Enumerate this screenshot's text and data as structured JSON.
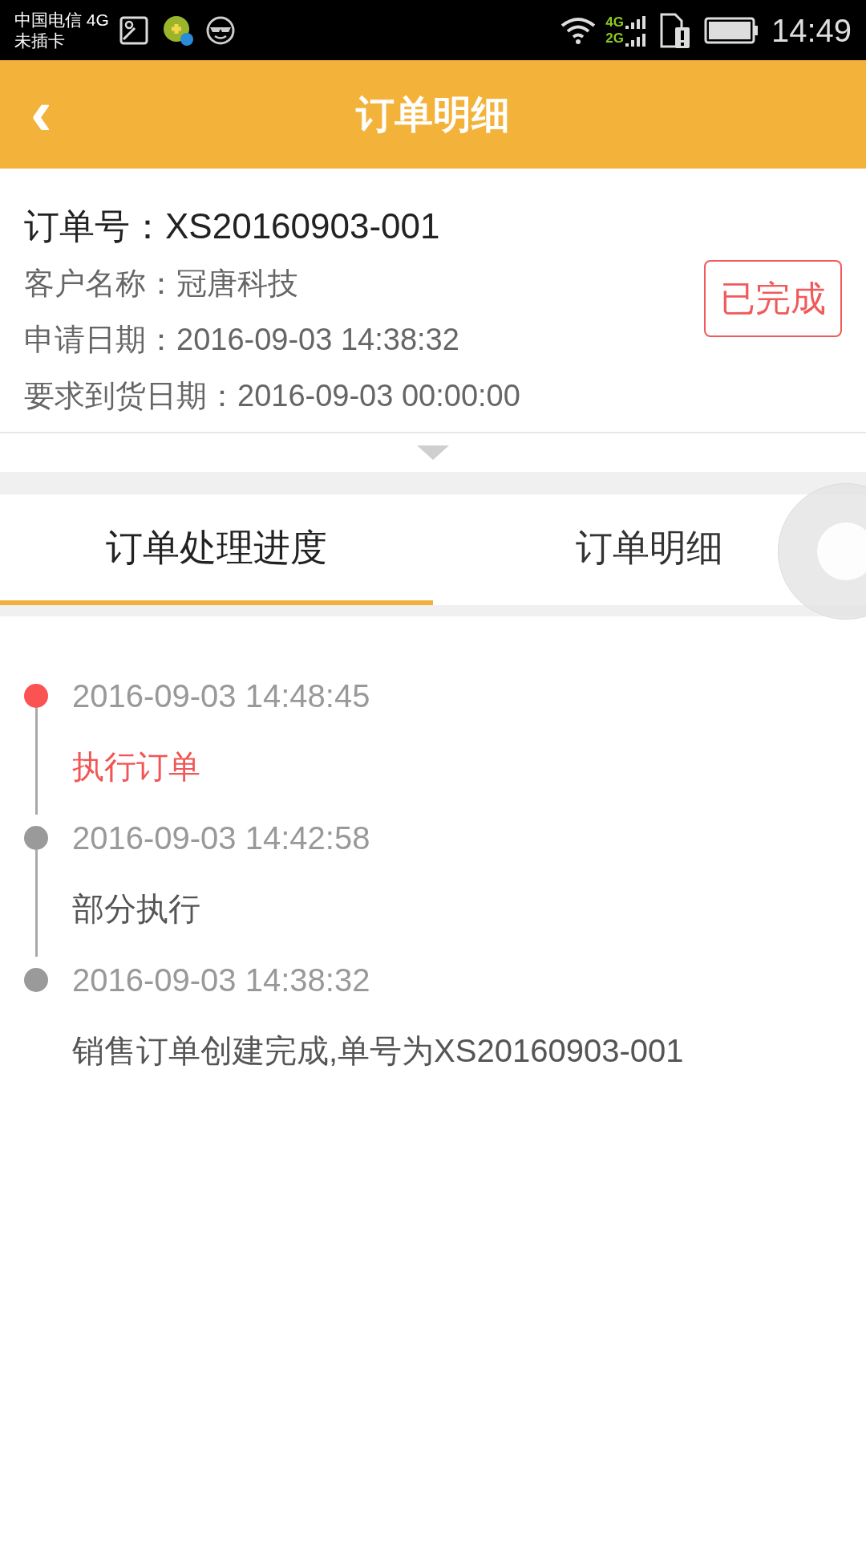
{
  "status_bar": {
    "carrier": "中国电信 4G",
    "sim_status": "未插卡",
    "network_top": "4G",
    "network_bottom": "2G",
    "time": "14:49"
  },
  "header": {
    "back": "‹",
    "title": "订单明细"
  },
  "order": {
    "number_label": "订单号：",
    "number": "XS20160903-001",
    "fields": [
      {
        "label": "客户名称：",
        "value": "冠唐科技"
      },
      {
        "label": "申请日期：",
        "value": "2016-09-03 14:38:32"
      },
      {
        "label": "要求到货日期：",
        "value": "2016-09-03 00:00:00"
      }
    ],
    "status": "已完成"
  },
  "tabs": [
    {
      "label": "订单处理进度",
      "selected": true
    },
    {
      "label": "订单明细",
      "selected": false
    }
  ],
  "timeline": [
    {
      "time": "2016-09-03 14:48:45",
      "text": "执行订单",
      "active": true
    },
    {
      "time": "2016-09-03 14:42:58",
      "text": "部分执行",
      "active": false
    },
    {
      "time": "2016-09-03 14:38:32",
      "text": "销售订单创建完成,单号为XS20160903-001",
      "active": false
    }
  ]
}
